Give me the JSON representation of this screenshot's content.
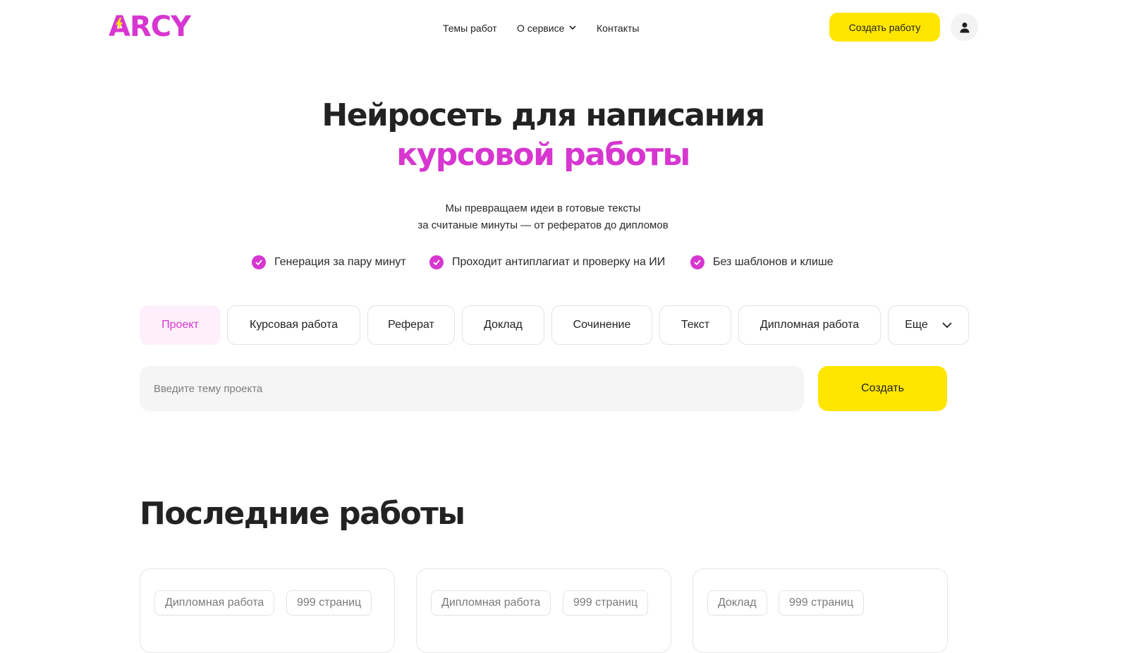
{
  "header": {
    "logo": "ARCY",
    "nav": [
      {
        "label": "Темы работ"
      },
      {
        "label": "О сервисе"
      },
      {
        "label": "Контакты"
      }
    ],
    "create_button": "Создать работу",
    "profile_icon": "user-icon"
  },
  "hero": {
    "title_line1": "Нейросеть для написания",
    "title_line2": "курсовой работы",
    "subtitle_line1": "Мы превращаем идеи в готовые тексты",
    "subtitle_line2": "за считаные минуты — от рефератов до дипломов",
    "features": [
      {
        "label": "Генерация за пару минут",
        "icon": "check-icon"
      },
      {
        "label": "Проходит антиплагиат и проверку на ИИ",
        "icon": "check-icon"
      },
      {
        "label": "Без шаблонов и клише",
        "icon": "check-icon"
      }
    ],
    "work_types": [
      {
        "label": "Проект",
        "active": true
      },
      {
        "label": "Курсовая работа",
        "active": false
      },
      {
        "label": "Реферат",
        "active": false
      },
      {
        "label": "Доклад",
        "active": false
      },
      {
        "label": "Сочинение",
        "active": false
      },
      {
        "label": "Текст",
        "active": false
      },
      {
        "label": "Дипломная работа",
        "active": false
      }
    ],
    "more_label": "Еще",
    "topic_placeholder": "Введите тему проекта",
    "topic_value": "",
    "submit_label": "Создать"
  },
  "recent": {
    "title": "Последние работы",
    "cards": [
      {
        "type": "Дипломная работа",
        "pages": "999 страниц"
      },
      {
        "type": "Дипломная работа",
        "pages": "999 страниц"
      },
      {
        "type": "Доклад",
        "pages": "999 страниц"
      }
    ]
  },
  "colors": {
    "accent": "#d736d0",
    "primary_button": "#ffe600",
    "text": "#222222",
    "muted": "#7a7a7a"
  }
}
